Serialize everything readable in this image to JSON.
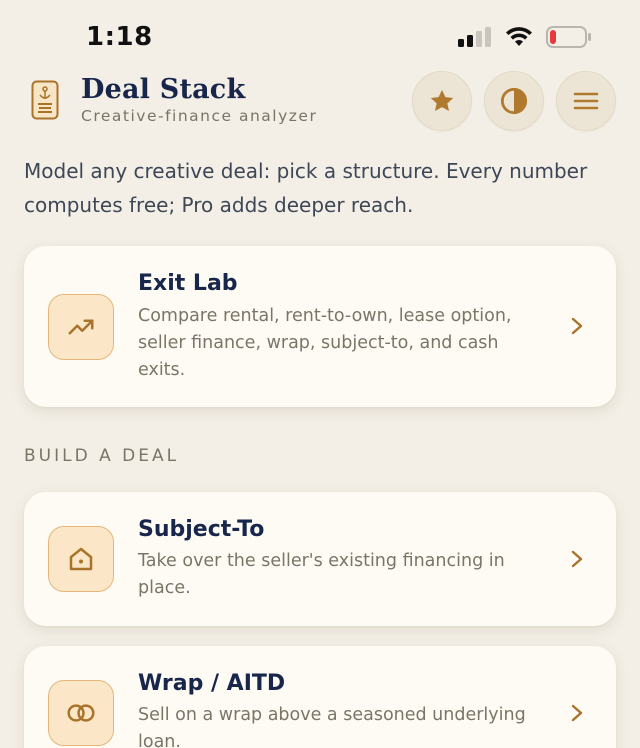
{
  "status_bar": {
    "time": "1:18"
  },
  "header": {
    "title": "Deal Stack",
    "subtitle": "Creative-finance analyzer",
    "buttons": [
      {
        "icon": "star-icon"
      },
      {
        "icon": "contrast-icon"
      },
      {
        "icon": "menu-icon"
      }
    ]
  },
  "intro": "Model any creative deal: pick a structure. Every number computes free; Pro adds deeper reach.",
  "featured": {
    "title": "Exit Lab",
    "description": "Compare rental, rent-to-own, lease option, seller finance, wrap, subject-to, and cash exits.",
    "icon": "trending-up-icon"
  },
  "section_label": "BUILD A DEAL",
  "deals": [
    {
      "title": "Subject-To",
      "description": "Take over the seller's existing financing in place.",
      "icon": "home-icon"
    },
    {
      "title": "Wrap / AITD",
      "description": "Sell on a wrap above a seasoned underlying loan.",
      "icon": "rings-icon"
    }
  ],
  "colors": {
    "background": "#f3efe6",
    "card": "#fdfbf4",
    "accent": "#b07a2e",
    "title": "#17264a",
    "icon_bg": "#fbe7c8"
  }
}
